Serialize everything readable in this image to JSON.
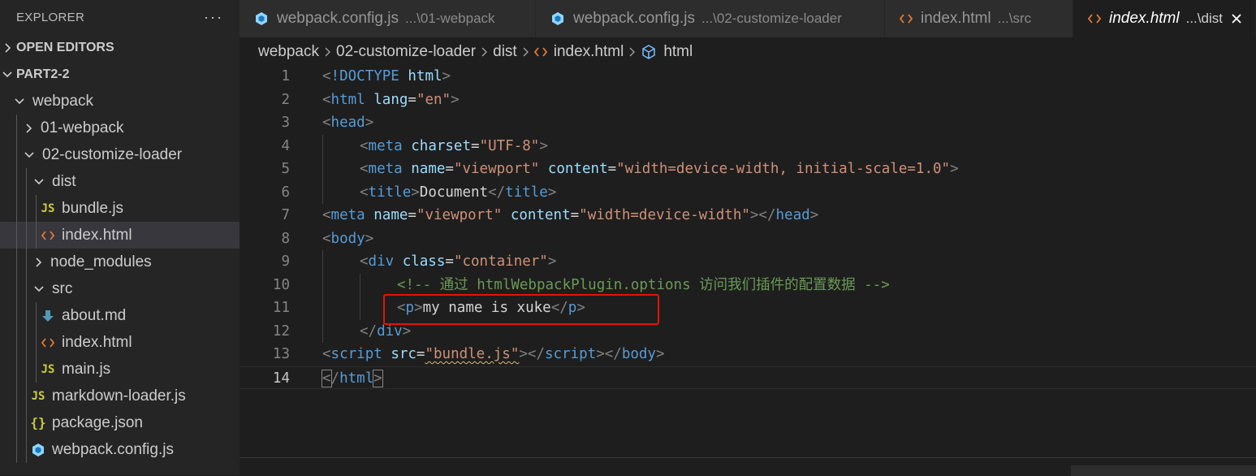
{
  "sidebar": {
    "title": "EXPLORER",
    "more": "···",
    "open_editors": "OPEN EDITORS",
    "workspace": "PART2-2",
    "tree": [
      {
        "label": "webpack",
        "kind": "folder-open",
        "depth": 1
      },
      {
        "label": "01-webpack",
        "kind": "folder-closed",
        "depth": 2
      },
      {
        "label": "02-customize-loader",
        "kind": "folder-open",
        "depth": 2
      },
      {
        "label": "dist",
        "kind": "folder-open",
        "depth": 3
      },
      {
        "label": "bundle.js",
        "kind": "js",
        "depth": 4
      },
      {
        "label": "index.html",
        "kind": "html",
        "depth": 4,
        "selected": true
      },
      {
        "label": "node_modules",
        "kind": "folder-closed",
        "depth": 3
      },
      {
        "label": "src",
        "kind": "folder-open",
        "depth": 3
      },
      {
        "label": "about.md",
        "kind": "md",
        "depth": 4
      },
      {
        "label": "index.html",
        "kind": "html",
        "depth": 4
      },
      {
        "label": "main.js",
        "kind": "js",
        "depth": 4
      },
      {
        "label": "markdown-loader.js",
        "kind": "js",
        "depth": 3
      },
      {
        "label": "package.json",
        "kind": "json",
        "depth": 3
      },
      {
        "label": "webpack.config.js",
        "kind": "webpack",
        "depth": 3
      }
    ]
  },
  "tabs": [
    {
      "name": "webpack.config.js",
      "desc": "...\\01-webpack",
      "icon": "webpack-icon",
      "active": false
    },
    {
      "name": "webpack.config.js",
      "desc": "...\\02-customize-loader",
      "icon": "webpack-icon",
      "active": false
    },
    {
      "name": "index.html",
      "desc": "...\\src",
      "icon": "html-icon",
      "active": false
    },
    {
      "name": "index.html",
      "desc": "...\\dist",
      "icon": "html-icon",
      "active": true
    }
  ],
  "breadcrumb": [
    "webpack",
    "02-customize-loader",
    "dist",
    "index.html",
    "html"
  ],
  "code_lines": [
    {
      "n": "1",
      "indent": 0,
      "tokens": [
        [
          "br",
          "<"
        ],
        [
          "tag",
          "!DOCTYPE"
        ],
        [
          "text",
          " "
        ],
        [
          "attr",
          "html"
        ],
        [
          "br",
          ">"
        ]
      ]
    },
    {
      "n": "2",
      "indent": 0,
      "tokens": [
        [
          "br",
          "<"
        ],
        [
          "tag",
          "html"
        ],
        [
          "text",
          " "
        ],
        [
          "attr",
          "lang"
        ],
        [
          "text",
          "="
        ],
        [
          "str",
          "\"en\""
        ],
        [
          "br",
          ">"
        ]
      ]
    },
    {
      "n": "3",
      "indent": 0,
      "tokens": [
        [
          "br",
          "<"
        ],
        [
          "tag",
          "head"
        ],
        [
          "br",
          ">"
        ]
      ]
    },
    {
      "n": "4",
      "indent": 1,
      "tokens": [
        [
          "br",
          "<"
        ],
        [
          "tag",
          "meta"
        ],
        [
          "text",
          " "
        ],
        [
          "attr",
          "charset"
        ],
        [
          "text",
          "="
        ],
        [
          "str",
          "\"UTF-8\""
        ],
        [
          "br",
          ">"
        ]
      ]
    },
    {
      "n": "5",
      "indent": 1,
      "tokens": [
        [
          "br",
          "<"
        ],
        [
          "tag",
          "meta"
        ],
        [
          "text",
          " "
        ],
        [
          "attr",
          "name"
        ],
        [
          "text",
          "="
        ],
        [
          "str",
          "\"viewport\""
        ],
        [
          "text",
          " "
        ],
        [
          "attr",
          "content"
        ],
        [
          "text",
          "="
        ],
        [
          "str",
          "\"width=device-width, initial-scale=1.0\""
        ],
        [
          "br",
          ">"
        ]
      ]
    },
    {
      "n": "6",
      "indent": 1,
      "tokens": [
        [
          "br",
          "<"
        ],
        [
          "tag",
          "title"
        ],
        [
          "br",
          ">"
        ],
        [
          "text",
          "Document"
        ],
        [
          "br",
          "</"
        ],
        [
          "tag",
          "title"
        ],
        [
          "br",
          ">"
        ]
      ]
    },
    {
      "n": "7",
      "indent": 0,
      "tokens": [
        [
          "br",
          "<"
        ],
        [
          "tag",
          "meta"
        ],
        [
          "text",
          " "
        ],
        [
          "attr",
          "name"
        ],
        [
          "text",
          "="
        ],
        [
          "str",
          "\"viewport\""
        ],
        [
          "text",
          " "
        ],
        [
          "attr",
          "content"
        ],
        [
          "text",
          "="
        ],
        [
          "str",
          "\"width=device-width\""
        ],
        [
          "br",
          "></"
        ],
        [
          "tag",
          "head"
        ],
        [
          "br",
          ">"
        ]
      ]
    },
    {
      "n": "8",
      "indent": 0,
      "tokens": [
        [
          "br",
          "<"
        ],
        [
          "tag",
          "body"
        ],
        [
          "br",
          ">"
        ]
      ]
    },
    {
      "n": "9",
      "indent": 1,
      "tokens": [
        [
          "br",
          "<"
        ],
        [
          "tag",
          "div"
        ],
        [
          "text",
          " "
        ],
        [
          "attr",
          "class"
        ],
        [
          "text",
          "="
        ],
        [
          "str",
          "\"container\""
        ],
        [
          "br",
          ">"
        ]
      ]
    },
    {
      "n": "10",
      "indent": 2,
      "tokens": [
        [
          "com",
          "<!-- 通过 htmlWebpackPlugin.options 访问我们插件的配置数据 -->"
        ]
      ]
    },
    {
      "n": "11",
      "indent": 2,
      "tokens": [
        [
          "br",
          "<"
        ],
        [
          "tag",
          "p"
        ],
        [
          "br",
          ">"
        ],
        [
          "text",
          "my name is xuke"
        ],
        [
          "br",
          "</"
        ],
        [
          "tag",
          "p"
        ],
        [
          "br",
          ">"
        ]
      ]
    },
    {
      "n": "12",
      "indent": 1,
      "tokens": [
        [
          "br",
          "</"
        ],
        [
          "tag",
          "div"
        ],
        [
          "br",
          ">"
        ]
      ]
    },
    {
      "n": "13",
      "indent": 0,
      "tokens": [
        [
          "br",
          "<"
        ],
        [
          "tag",
          "script"
        ],
        [
          "text",
          " "
        ],
        [
          "attr",
          "src"
        ],
        [
          "text",
          "="
        ],
        [
          "str-u",
          "\"bundle.js\""
        ],
        [
          "br",
          "></"
        ],
        [
          "tag",
          "script"
        ],
        [
          "br",
          "></"
        ],
        [
          "tag",
          "body"
        ],
        [
          "br",
          ">"
        ]
      ]
    },
    {
      "n": "14",
      "indent": 0,
      "current": true,
      "tokens": [
        [
          "br-box",
          "<"
        ],
        [
          "br",
          "/"
        ],
        [
          "tag",
          "html"
        ],
        [
          "br-box",
          ">"
        ]
      ]
    }
  ],
  "colors": {
    "editor_bg": "#1e1e1e",
    "sidebar_bg": "#252526",
    "tag": "#569cd6",
    "attr": "#9cdcfe",
    "string": "#ce9178",
    "comment": "#6a9955",
    "highlight_box": "#e51400"
  }
}
